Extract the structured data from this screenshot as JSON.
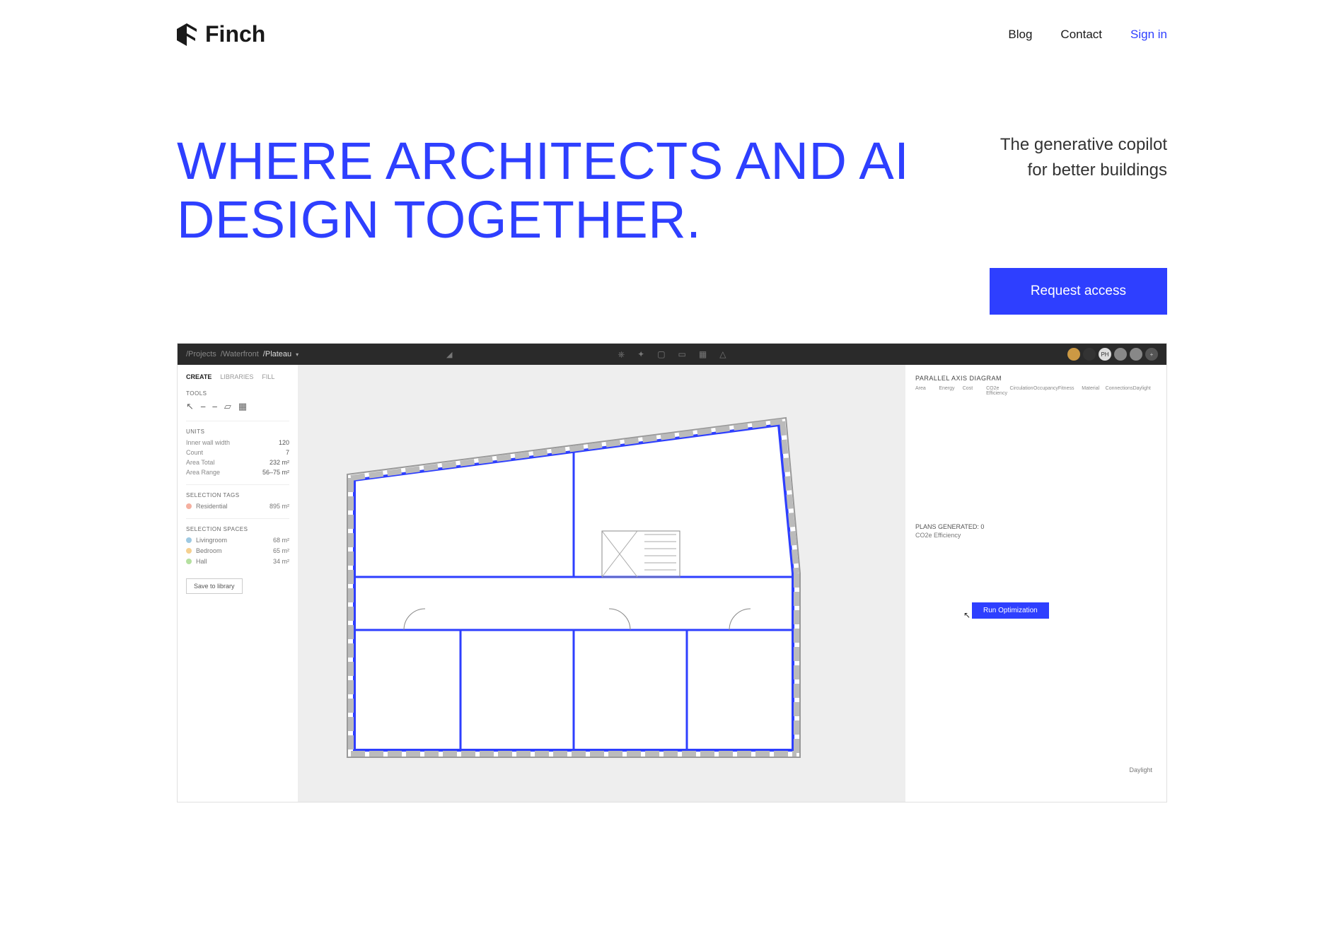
{
  "brand": "Finch",
  "nav": {
    "blog": "Blog",
    "contact": "Contact",
    "signin": "Sign in"
  },
  "hero": {
    "title": "WHERE ARCHITECTS AND AI DESIGN TOGETHER.",
    "subtitle1": "The generative copilot",
    "subtitle2": "for better buildings",
    "cta": "Request access"
  },
  "app": {
    "breadcrumb1": "/Projects",
    "breadcrumb2": "/Waterfront",
    "breadcrumb3": "/Plateau",
    "avatar_ph": "PH",
    "side_tabs": {
      "create": "CREATE",
      "libraries": "LIBRARIES",
      "fill": "FILL"
    },
    "tools_title": "TOOLS",
    "units_title": "UNITS",
    "units": {
      "inner_wall_label": "Inner wall width",
      "inner_wall_value": "120",
      "count_label": "Count",
      "count_value": "7",
      "area_total_label": "Area Total",
      "area_total_value": "232 m²",
      "area_range_label": "Area Range",
      "area_range_value": "56–75 m²"
    },
    "selection_tags_title": "SELECTION TAGS",
    "tag_residential": "Residential",
    "tag_residential_val": "895 m²",
    "selection_spaces_title": "SELECTION SPACES",
    "space_living": "Livingroom",
    "space_living_val": "68 m²",
    "space_bedroom": "Bedroom",
    "space_bedroom_val": "65 m²",
    "space_hall": "Hall",
    "space_hall_val": "34 m²",
    "save_library": "Save to library",
    "parallel_title": "PARALLEL AXIS DIAGRAM",
    "axes": {
      "a0": "Area",
      "a1": "Energy",
      "a2": "Cost",
      "a3": "CO2e Efficiency",
      "a4": "Circulation",
      "a5": "Occupancy",
      "a6": "Fitness",
      "a7": "Material",
      "a8": "Connections",
      "a9": "Daylight"
    },
    "plans_generated": "PLANS GENERATED: 0",
    "co2_label": "CO2e Efficiency",
    "run_opt": "Run Optimization",
    "daylight": "Daylight"
  }
}
